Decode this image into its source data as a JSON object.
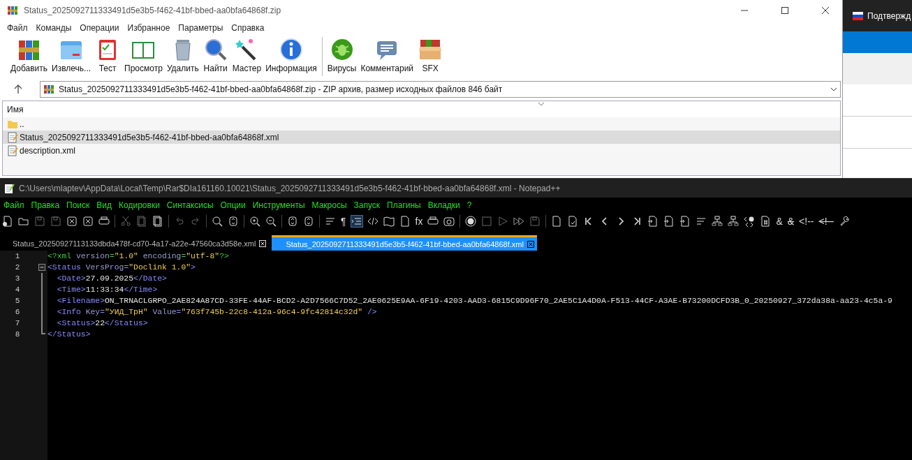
{
  "winrar": {
    "title": "Status_2025092711333491d5e3b5-f462-41bf-bbed-aa0bfa64868f.zip",
    "menu": [
      "Файл",
      "Команды",
      "Операции",
      "Избранное",
      "Параметры",
      "Справка"
    ],
    "toolbar": [
      "Добавить",
      "Извлечь...",
      "Тест",
      "Просмотр",
      "Удалить",
      "Найти",
      "Мастер",
      "Информация",
      "Вирусы",
      "Комментарий",
      "SFX"
    ],
    "address": "Status_2025092711333491d5e3b5-f462-41bf-bbed-aa0bfa64868f.zip - ZIP архив, размер исходных файлов 846 байт",
    "columns": [
      "Имя"
    ],
    "files": [
      {
        "name": "..",
        "kind": "up",
        "selected": false
      },
      {
        "name": "Status_2025092711333491d5e3b5-f462-41bf-bbed-aa0bfa64868f.xml",
        "kind": "xml",
        "selected": true
      },
      {
        "name": "description.xml",
        "kind": "xml",
        "selected": false
      }
    ]
  },
  "background_app": {
    "label": "Подтвержд"
  },
  "notepad": {
    "title": "C:\\Users\\mlaptev\\AppData\\Local\\Temp\\Rar$DIa161160.10021\\Status_2025092711333491d5e3b5-f462-41bf-bbed-aa0bfa64868f.xml - Notepad++",
    "menu": [
      "Файл",
      "Правка",
      "Поиск",
      "Вид",
      "Кодировки",
      "Синтаксисы",
      "Опции",
      "Инструменты",
      "Макросы",
      "Запуск",
      "Плагины",
      "Вкладки",
      "?"
    ],
    "toolbar_glyphs": [
      {
        "text": "¶",
        "crossed": false
      },
      {
        "text": "fx",
        "crossed": false
      },
      {
        "text": "&",
        "crossed": false
      },
      {
        "text": "&",
        "crossed": true
      },
      {
        "text": "<!--",
        "crossed": false
      },
      {
        "text": "<!--",
        "crossed": true
      }
    ],
    "tabs": [
      {
        "label": "Status_20250927113133dbda478f-cd70-4a17-a22e-47560ca3d58e.xml",
        "selected": false
      },
      {
        "label": "Status_2025092711333491d5e3b5-f462-41bf-bbed-aa0bfa64868f.xml",
        "selected": true
      }
    ],
    "lines": [
      {
        "number": "1",
        "kind": "plain",
        "tokens": [
          {
            "kind": "decl",
            "text": "<?xml "
          },
          {
            "kind": "attr",
            "text": "version"
          },
          {
            "kind": "decl",
            "text": "="
          },
          {
            "kind": "value",
            "text": "\"1.0\""
          },
          {
            "kind": "attr",
            "text": " encoding"
          },
          {
            "kind": "decl",
            "text": "="
          },
          {
            "kind": "value",
            "text": "\"utf-8\""
          },
          {
            "kind": "decl",
            "text": "?>"
          }
        ]
      },
      {
        "number": "2",
        "kind": "fold-start",
        "tokens": [
          {
            "kind": "tag",
            "text": "<Status "
          },
          {
            "kind": "attr",
            "text": "VersProg"
          },
          {
            "kind": "tag",
            "text": "="
          },
          {
            "kind": "value",
            "text": "\"Doclink 1.0\""
          },
          {
            "kind": "tag",
            "text": ">"
          }
        ]
      },
      {
        "number": "3",
        "kind": "fold-inner",
        "tokens": [
          {
            "kind": "tag",
            "text": "  <Date>"
          },
          {
            "kind": "text",
            "text": "27.09.2025"
          },
          {
            "kind": "tag",
            "text": "</Date>"
          }
        ]
      },
      {
        "number": "4",
        "kind": "fold-inner",
        "tokens": [
          {
            "kind": "tag",
            "text": "  <Time>"
          },
          {
            "kind": "text",
            "text": "11:33:34"
          },
          {
            "kind": "tag",
            "text": "</Time>"
          }
        ]
      },
      {
        "number": "5",
        "kind": "fold-inner",
        "tokens": [
          {
            "kind": "tag",
            "text": "  <Filename>"
          },
          {
            "kind": "text",
            "text": "ON_TRNACLGRPO_2AE824A87CD-33FE-44AF-BCD2-A2D7566C7D52_2AE0625E9AA-6F19-4203-AAD3-6815C9D96F70_2AE5C1A4D0A-F513-44CF-A3AE-B73200DCFD3B_0_20250927_372da38a-aa23-4c5a-9"
          }
        ]
      },
      {
        "number": "6",
        "kind": "fold-inner",
        "tokens": [
          {
            "kind": "tag",
            "text": "  <Info "
          },
          {
            "kind": "attr",
            "text": "Key"
          },
          {
            "kind": "tag",
            "text": "="
          },
          {
            "kind": "value",
            "text": "\"УИД_ТрН\""
          },
          {
            "kind": "attr",
            "text": " Value"
          },
          {
            "kind": "tag",
            "text": "="
          },
          {
            "kind": "value",
            "text": "\"763f745b-22c8-412a-96c4-9fc42814c32d\""
          },
          {
            "kind": "tag",
            "text": " />"
          }
        ]
      },
      {
        "number": "7",
        "kind": "fold-inner",
        "tokens": [
          {
            "kind": "tag",
            "text": "  <Status>"
          },
          {
            "kind": "text",
            "text": "22"
          },
          {
            "kind": "tag",
            "text": "</Status>"
          }
        ]
      },
      {
        "number": "8",
        "kind": "fold-end",
        "tokens": [
          {
            "kind": "tag",
            "text": "</Status>"
          }
        ]
      }
    ]
  }
}
